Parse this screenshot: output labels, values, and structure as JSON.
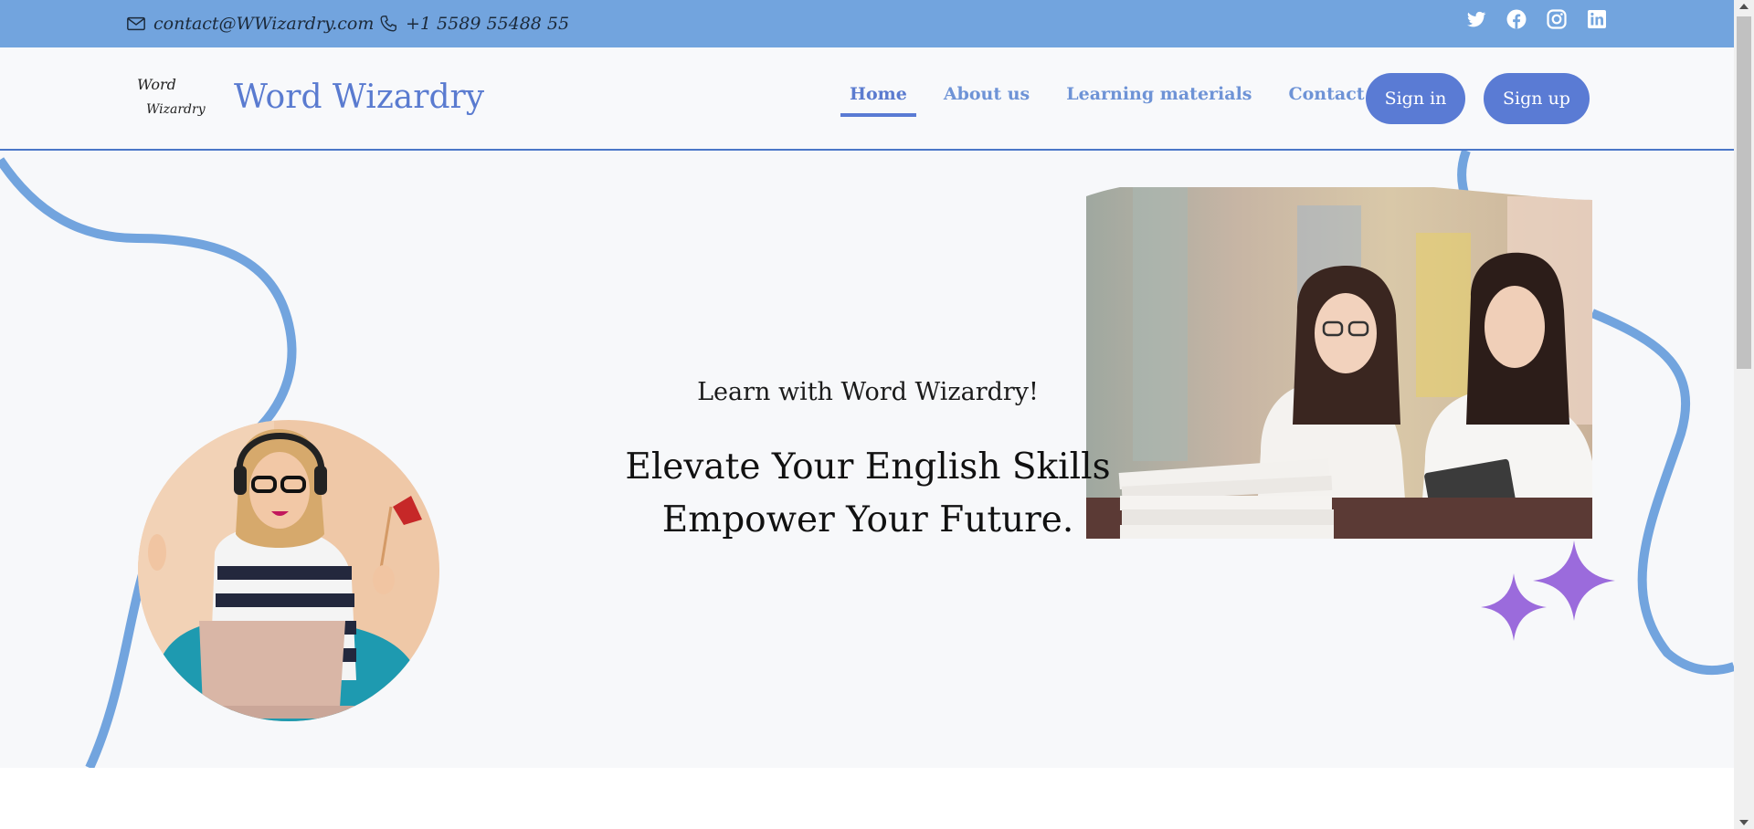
{
  "topbar": {
    "email": "contact@WWizardry.com",
    "phone": "+1 5589 55488 55",
    "socials": [
      "twitter-icon",
      "facebook-icon",
      "instagram-icon",
      "linkedin-icon"
    ],
    "color": "#72a4de"
  },
  "header": {
    "logo_line1": "Word",
    "logo_line2": "Wizardry",
    "brand": "Word Wizardry",
    "nav": {
      "home": "Home",
      "about": "About us",
      "materials": "Learning materials",
      "contact": "Contact us"
    },
    "signin": "Sign in",
    "signup": "Sign up",
    "accent": "#5a7bd4"
  },
  "hero": {
    "tagline": "Learn with Word Wizardry!",
    "headline_line1": "Elevate Your English Skills",
    "headline_line2": "Empower Your Future.",
    "curve_color": "#72a4de",
    "sparkle_color": "#9b6bdc"
  }
}
